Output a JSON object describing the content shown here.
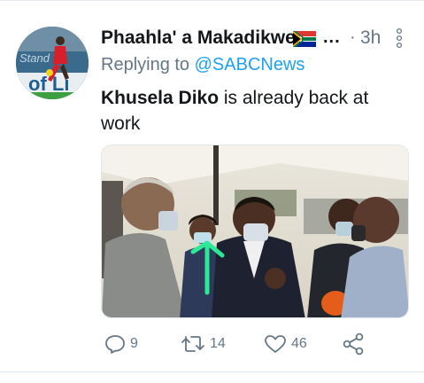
{
  "tweet": {
    "author": {
      "display_name": "Phaahla' a Makadikwe",
      "flag_emoji": "south-africa-flag"
    },
    "truncation": "...",
    "separator": "·",
    "timestamp": "3h",
    "reply": {
      "prefix": "Replying to ",
      "handle": "@SABCNews"
    },
    "text": {
      "bold": "Khusela Diko",
      "rest": " is already back at work"
    },
    "stats": {
      "replies": "9",
      "retweets": "14",
      "likes": "46"
    }
  },
  "colors": {
    "text_primary": "#14171a",
    "text_secondary": "#657786",
    "link": "#1da1f2",
    "arrow_annotation": "#2ee89a"
  },
  "icons": {
    "reply": "reply-icon",
    "retweet": "retweet-icon",
    "like": "heart-icon",
    "share": "share-icon",
    "menu": "vertical-dots-icon"
  }
}
